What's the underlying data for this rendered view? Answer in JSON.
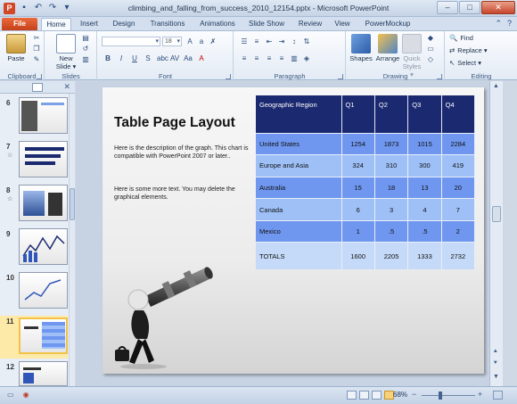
{
  "window": {
    "title": "climbing_and_falling_from_success_2010_12154.pptx  -  Microsoft PowerPoint",
    "app_letter": "P",
    "min": "–",
    "max": "□",
    "close": "✕"
  },
  "tabs": [
    "File",
    "Home",
    "Insert",
    "Design",
    "Transitions",
    "Animations",
    "Slide Show",
    "Review",
    "View",
    "PowerMockup"
  ],
  "active_tab": "Home",
  "ribbon": {
    "clipboard": {
      "label": "Clipboard",
      "paste": "Paste"
    },
    "slides": {
      "label": "Slides",
      "new_slide": "New Slide ▾"
    },
    "font": {
      "label": "Font",
      "size": "18"
    },
    "paragraph": {
      "label": "Paragraph"
    },
    "drawing": {
      "label": "Drawing",
      "shapes": "Shapes",
      "arrange": "Arrange",
      "quick_styles": "Quick Styles ▾"
    },
    "editing": {
      "label": "Editing",
      "find": "Find",
      "replace": "Replace ▾",
      "select": "Select ▾"
    }
  },
  "thumbnails": [
    {
      "num": "6"
    },
    {
      "num": "7",
      "star": "☆"
    },
    {
      "num": "8",
      "star": "☆"
    },
    {
      "num": "9"
    },
    {
      "num": "10"
    },
    {
      "num": "11"
    },
    {
      "num": "12"
    }
  ],
  "slide": {
    "title": "Table Page Layout",
    "desc1": "Here is the description of the graph.  This chart is compatible with PowerPoint 2007 or later..",
    "desc2": "Here is some more text.  You may delete the graphical elements.",
    "table": {
      "headers": [
        "Geographic Region",
        "Q1",
        "Q2",
        "Q3",
        "Q4"
      ],
      "rows": [
        [
          "United States",
          "1254",
          "1873",
          "1015",
          "2284"
        ],
        [
          "Europe and Asia",
          "324",
          "310",
          "300",
          "419"
        ],
        [
          "Australia",
          "15",
          "18",
          "13",
          "20"
        ],
        [
          "Canada",
          "6",
          "3",
          "4",
          "7"
        ],
        [
          "Mexico",
          "1",
          ".5",
          ".5",
          "2"
        ],
        [
          "TOTALS",
          "1600",
          "2205",
          "1333",
          "2732"
        ]
      ]
    }
  },
  "status": {
    "zoom": "68%",
    "minus": "−",
    "plus": "+"
  },
  "colors": {
    "table_header": "#1b2970",
    "row_dark": "#6f97f0",
    "row_light": "#9ec0f7",
    "accent_file": "#d24726"
  }
}
